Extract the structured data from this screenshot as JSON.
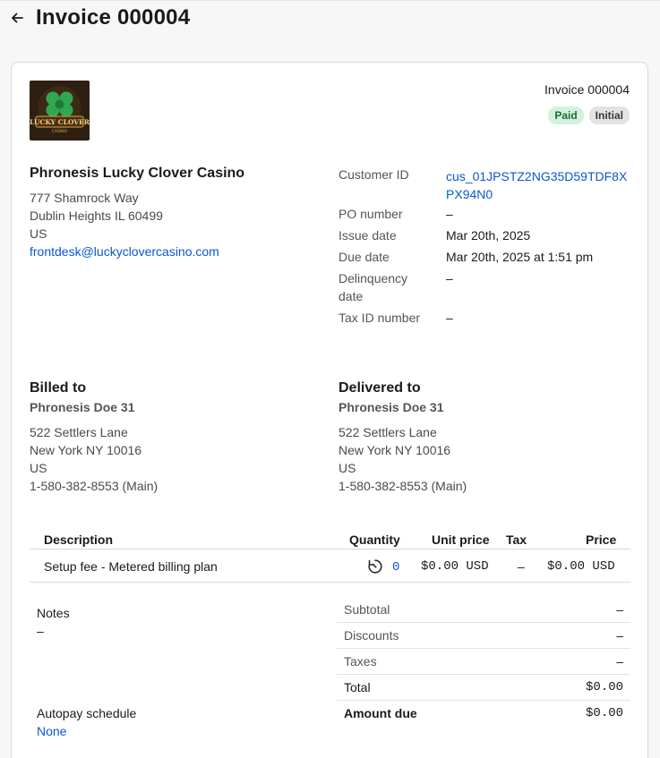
{
  "header": {
    "title": "Invoice 000004"
  },
  "invoice": {
    "label": "Invoice 000004",
    "badges": {
      "paid": "Paid",
      "initial": "Initial"
    }
  },
  "company": {
    "logo_text": "LUCKY CLOVER",
    "logo_subtext": "CASINO",
    "name": "Phronesis Lucky Clover Casino",
    "street": "777 Shamrock Way",
    "city": "Dublin Heights IL 60499",
    "country": "US",
    "email": "frontdesk@luckyclovercasino.com"
  },
  "meta": {
    "customer_id_label": "Customer ID",
    "customer_id": "cus_01JPSTZ2NG35D59TDF8XPX94N0",
    "po_label": "PO number",
    "po_value": "–",
    "issue_label": "Issue date",
    "issue_value": "Mar 20th, 2025",
    "due_label": "Due date",
    "due_value": "Mar 20th, 2025 at 1:51 pm",
    "delinquency_label_1": "Delinquency",
    "delinquency_label_2": "date",
    "delinquency_value": "–",
    "tax_id_label": "Tax ID number",
    "tax_id_value": "–"
  },
  "billed_to": {
    "title": "Billed to",
    "name": "Phronesis Doe 31",
    "street": "522 Settlers Lane",
    "city": "New York NY 10016",
    "country": "US",
    "phone": "1-580-382-8553 (Main)"
  },
  "delivered_to": {
    "title": "Delivered to",
    "name": "Phronesis Doe 31",
    "street": "522 Settlers Lane",
    "city": "New York NY 10016",
    "country": "US",
    "phone": "1-580-382-8553 (Main)"
  },
  "table": {
    "headers": {
      "description": "Description",
      "quantity": "Quantity",
      "unit_price": "Unit price",
      "tax": "Tax",
      "price": "Price"
    },
    "rows": [
      {
        "description": "Setup fee - Metered billing plan",
        "quantity": "0",
        "unit_price": "$0.00 USD",
        "tax": "–",
        "price": "$0.00 USD"
      }
    ]
  },
  "notes": {
    "label": "Notes",
    "value": "–"
  },
  "autopay": {
    "label": "Autopay schedule",
    "value": "None"
  },
  "summary": {
    "subtotal_label": "Subtotal",
    "subtotal": "–",
    "discounts_label": "Discounts",
    "discounts": "–",
    "taxes_label": "Taxes",
    "taxes": "–",
    "total_label": "Total",
    "total": "$0.00",
    "amount_due_label": "Amount due",
    "amount_due": "$0.00"
  },
  "colors": {
    "link": "#0b57d0",
    "paid_bg": "#d3f2dc",
    "paid_fg": "#1d6b35",
    "initial_bg": "#e3e3e5",
    "logo_bg": "#2d1f12",
    "logo_green": "#2fa84f",
    "logo_gold": "#d9a441"
  }
}
